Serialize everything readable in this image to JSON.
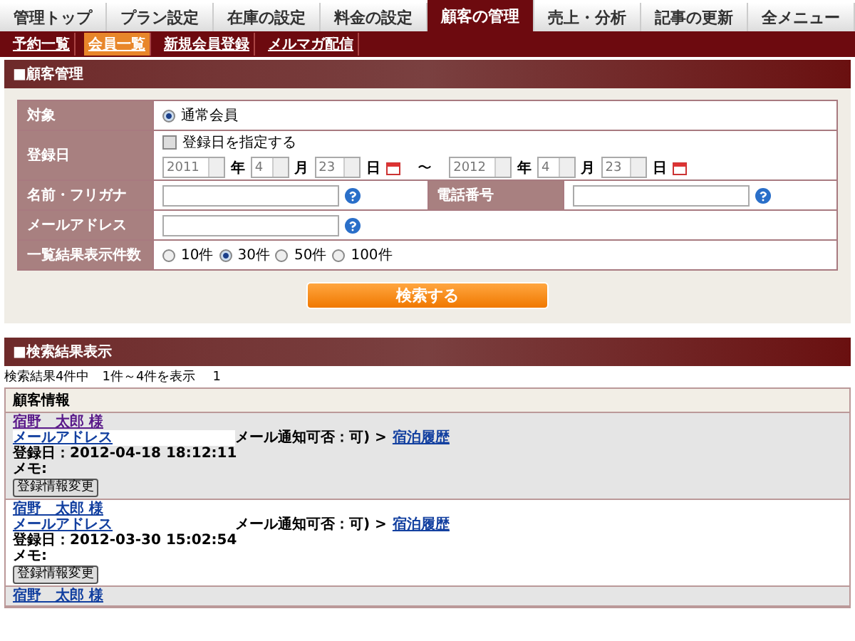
{
  "nav": {
    "tabs": [
      {
        "label": "管理トップ",
        "selected": false
      },
      {
        "label": "プラン設定",
        "selected": false
      },
      {
        "label": "在庫の設定",
        "selected": false
      },
      {
        "label": "料金の設定",
        "selected": false
      },
      {
        "label": "顧客の管理",
        "selected": true
      },
      {
        "label": "売上・分析",
        "selected": false
      },
      {
        "label": "記事の更新",
        "selected": false
      },
      {
        "label": "全メニュー",
        "selected": false
      }
    ]
  },
  "subnav": {
    "links": [
      {
        "label": "予約一覧",
        "selected": false
      },
      {
        "label": "会員一覧",
        "selected": true
      },
      {
        "label": "新規会員登録",
        "selected": false
      },
      {
        "label": "メルマガ配信",
        "selected": false
      }
    ]
  },
  "section_title": "■顧客管理",
  "form": {
    "target": {
      "label": "対象",
      "options": [
        {
          "label": "通常会員",
          "selected": true
        }
      ]
    },
    "registration_date": {
      "label": "登録日",
      "checkbox": {
        "label": "登録日を指定する",
        "checked": false
      },
      "from": [
        {
          "value": "2011",
          "unit": "年"
        },
        {
          "value": "4",
          "unit": "月"
        },
        {
          "value": "23",
          "unit": "日"
        }
      ],
      "separator": "〜",
      "to": [
        {
          "value": "2012",
          "unit": "年"
        },
        {
          "value": "4",
          "unit": "月"
        },
        {
          "value": "23",
          "unit": "日"
        }
      ]
    },
    "name": {
      "label": "名前・フリガナ"
    },
    "phone": {
      "label": "電話番号"
    },
    "email": {
      "label": "メールアドレス"
    },
    "page_size": {
      "label": "一覧結果表示件数",
      "options": [
        {
          "label": "10件",
          "selected": false
        },
        {
          "label": "30件",
          "selected": true
        },
        {
          "label": "50件",
          "selected": false
        },
        {
          "label": "100件",
          "selected": false
        }
      ]
    },
    "search_button": "検索する"
  },
  "results": {
    "title": "■検索結果表示",
    "summary": "検索結果4件中　1件～4件を表示",
    "page": "1",
    "column": "顧客情報",
    "rows": [
      {
        "name": "宿野　太郎 様",
        "email": "メールアドレス",
        "registered": "登録日：2012-04-18 18:12:11",
        "memo": "メモ:",
        "edit_button": "登録情報変更",
        "notice": "メール通知可否：可) >",
        "history": "宿泊履歴"
      },
      {
        "name": "宿野　太郎 様",
        "email": "メールアドレス",
        "registered": "登録日：2012-03-30 15:02:54",
        "memo": "メモ:",
        "edit_button": "登録情報変更",
        "notice": "メール通知可否：可) >",
        "history": "宿泊履歴"
      },
      {
        "name": "宿野　太郎 様"
      }
    ]
  }
}
